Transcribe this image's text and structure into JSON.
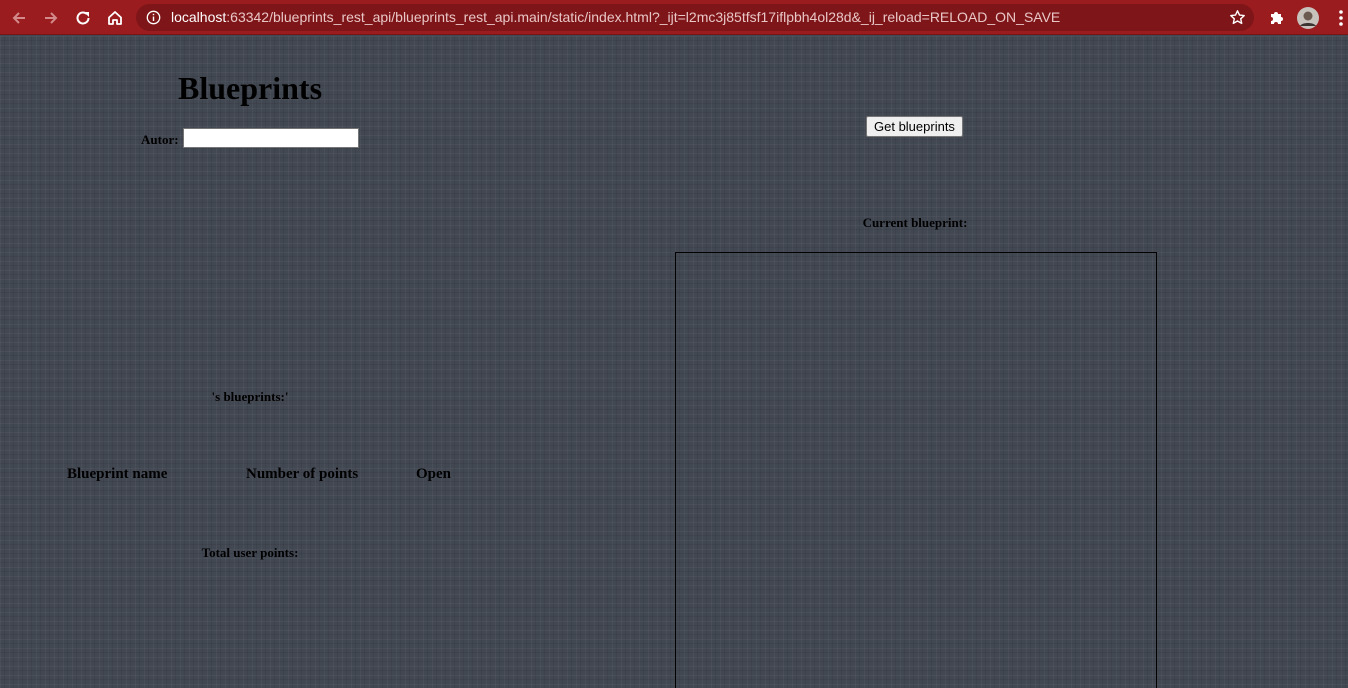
{
  "browser": {
    "url_host": "localhost",
    "url_rest": ":63342/blueprints_rest_api/blueprints_rest_api.main/static/index.html?_ijt=l2mc3j85tfsf17iflpbh4ol28d&_ij_reload=RELOAD_ON_SAVE",
    "icons": [
      "back-arrow-icon",
      "forward-arrow-icon",
      "reload-icon",
      "home-icon",
      "info-icon",
      "star-icon",
      "puzzle-icon",
      "avatar",
      "kebab-menu-icon"
    ],
    "colors": {
      "toolbar": "#9a1c1f",
      "omnibox": "#7e1518"
    }
  },
  "page": {
    "title": "Blueprints",
    "author_label": "Autor:",
    "author_value": "",
    "get_button_label": "Get blueprints",
    "owner_label": "'s blueprints:'",
    "table_headers": [
      "Blueprint name",
      "Number of points",
      "Open"
    ],
    "table_rows": [],
    "total_label": "Total user points:",
    "current_label": "Current blueprint:",
    "colors": {
      "background": "#424852"
    }
  }
}
